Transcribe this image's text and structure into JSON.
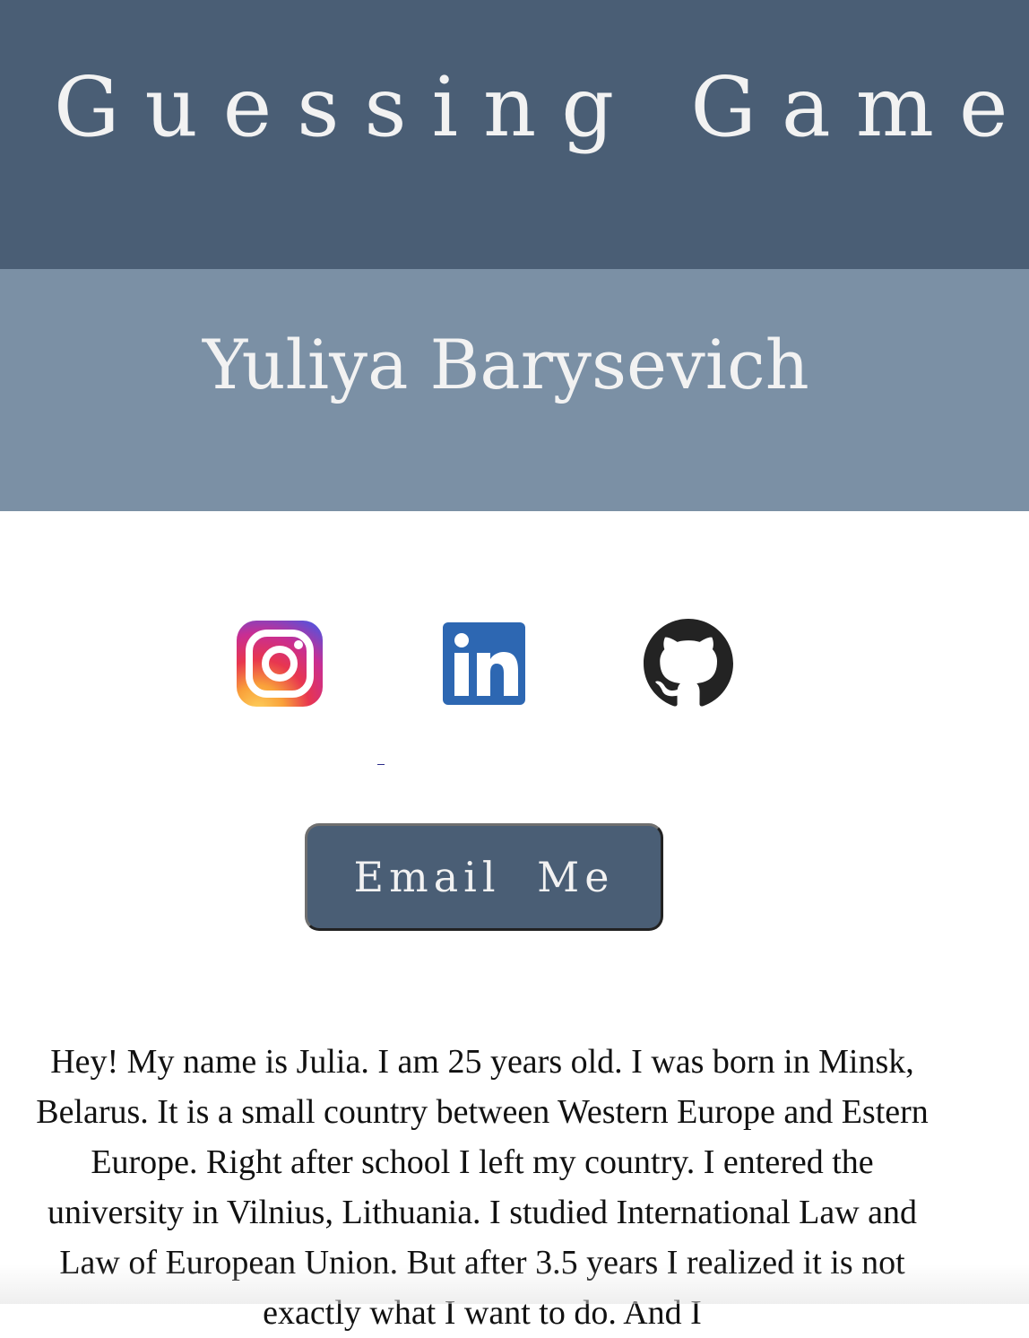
{
  "header": {
    "title": "Guessing Game",
    "background_color": "#4a5e75"
  },
  "subheader": {
    "name": "Yuliya Barysevich",
    "background_color": "#7b90a5"
  },
  "social_links": [
    {
      "icon": "instagram-icon"
    },
    {
      "icon": "linkedin-icon"
    },
    {
      "icon": "github-icon"
    }
  ],
  "email_button": {
    "label": "Email Me"
  },
  "bio": {
    "text": "Hey! My name is Julia. I am 25 years old. I was born in Minsk, Belarus. It is a small country between Western Europe and Estern Europe. Right after school I left my country. I entered the university in Vilnius, Lithuania. I studied International Law and Law of European Union. But after 3.5 years I realized it is not exactly what I want to do. And I"
  }
}
